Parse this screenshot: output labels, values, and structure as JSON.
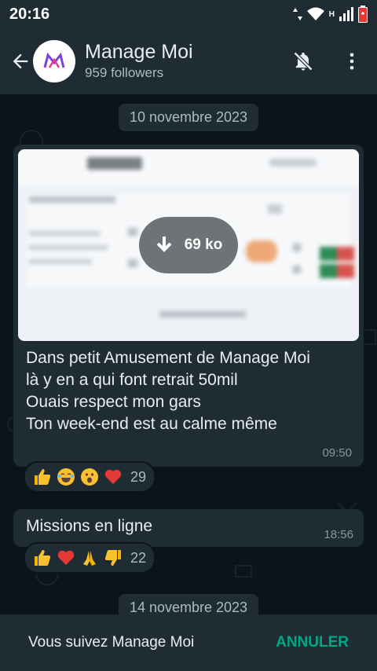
{
  "status": {
    "time": "20:16",
    "network_label": "H"
  },
  "header": {
    "channel_name": "Manage Moi",
    "followers": "959 followers",
    "avatar_label": "M",
    "icons": [
      "back-arrow-icon",
      "bell-off-icon",
      "more-vert-icon"
    ]
  },
  "messages": {
    "date1": "10 novembre 2023",
    "msg1": {
      "download_size": "69 ko",
      "lines": [
        "Dans petit Amusement de Manage Moi",
        "là y en a qui font retrait 50mil",
        "Ouais respect mon gars",
        "Ton week-end est au calme même"
      ],
      "time": "09:50",
      "reactions": {
        "emojis": [
          "thumbs-up",
          "laughing",
          "surprised",
          "red-heart"
        ],
        "count": "29"
      }
    },
    "msg2": {
      "text": "Missions en ligne",
      "time": "18:56",
      "reactions": {
        "emojis": [
          "thumbs-up",
          "red-heart",
          "folded-hands",
          "thumbs-down"
        ],
        "count": "22"
      }
    },
    "date2": "14 novembre 2023"
  },
  "footer": {
    "following_text": "Vous suivez Manage Moi",
    "cancel_label": "ANNULER"
  },
  "colors": {
    "background": "#0b141a",
    "bar": "#1f2c34",
    "accent": "#00a884"
  }
}
